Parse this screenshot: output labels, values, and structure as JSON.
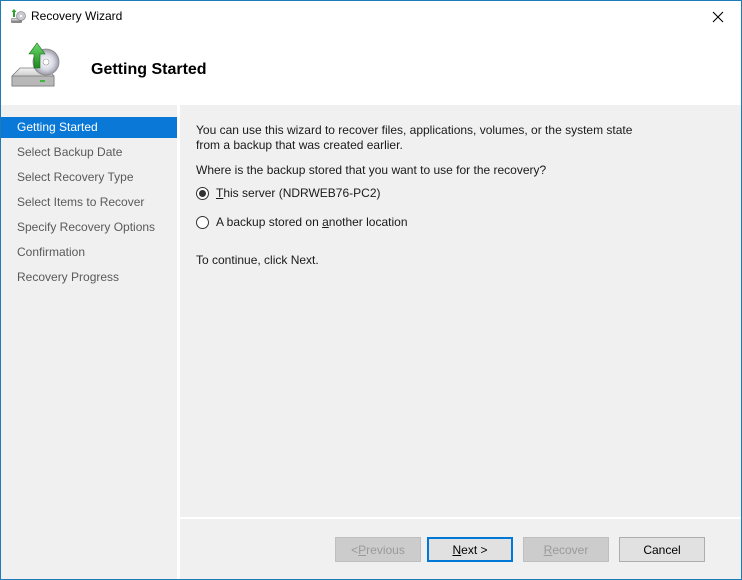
{
  "window": {
    "title": "Recovery Wizard",
    "close_label": "✕",
    "border_color": "#1c7bb8"
  },
  "header": {
    "title": "Getting Started",
    "icon": "backup-recovery-icon"
  },
  "sidebar": {
    "active_color": "#0a78d7",
    "items": [
      {
        "label": "Getting Started",
        "active": true
      },
      {
        "label": "Select Backup Date",
        "active": false
      },
      {
        "label": "Select Recovery Type",
        "active": false
      },
      {
        "label": "Select Items to Recover",
        "active": false
      },
      {
        "label": "Specify Recovery Options",
        "active": false
      },
      {
        "label": "Confirmation",
        "active": false
      },
      {
        "label": "Recovery Progress",
        "active": false
      }
    ]
  },
  "content": {
    "intro_line1": "You can use this wizard to recover files, applications, volumes, or the system state",
    "intro_line2": "from a backup that was created earlier.",
    "question": "Where is the backup stored that you want to use for the recovery?",
    "options": [
      {
        "mnemonic": "T",
        "rest": "his server (NDRWEB76-PC2)",
        "selected": true
      },
      {
        "prefix": "A backup stored on ",
        "mnemonic": "a",
        "rest": "nother location",
        "selected": false
      }
    ],
    "continue_text": "To continue, click Next."
  },
  "buttons": {
    "previous": {
      "prefix": "< ",
      "mnemonic": "P",
      "rest": "revious",
      "enabled": false
    },
    "next": {
      "mnemonic": "N",
      "rest": "ext >",
      "enabled": true,
      "default": true
    },
    "recover": {
      "mnemonic": "R",
      "rest": "ecover",
      "enabled": false
    },
    "cancel": {
      "label": "Cancel",
      "enabled": true
    }
  }
}
